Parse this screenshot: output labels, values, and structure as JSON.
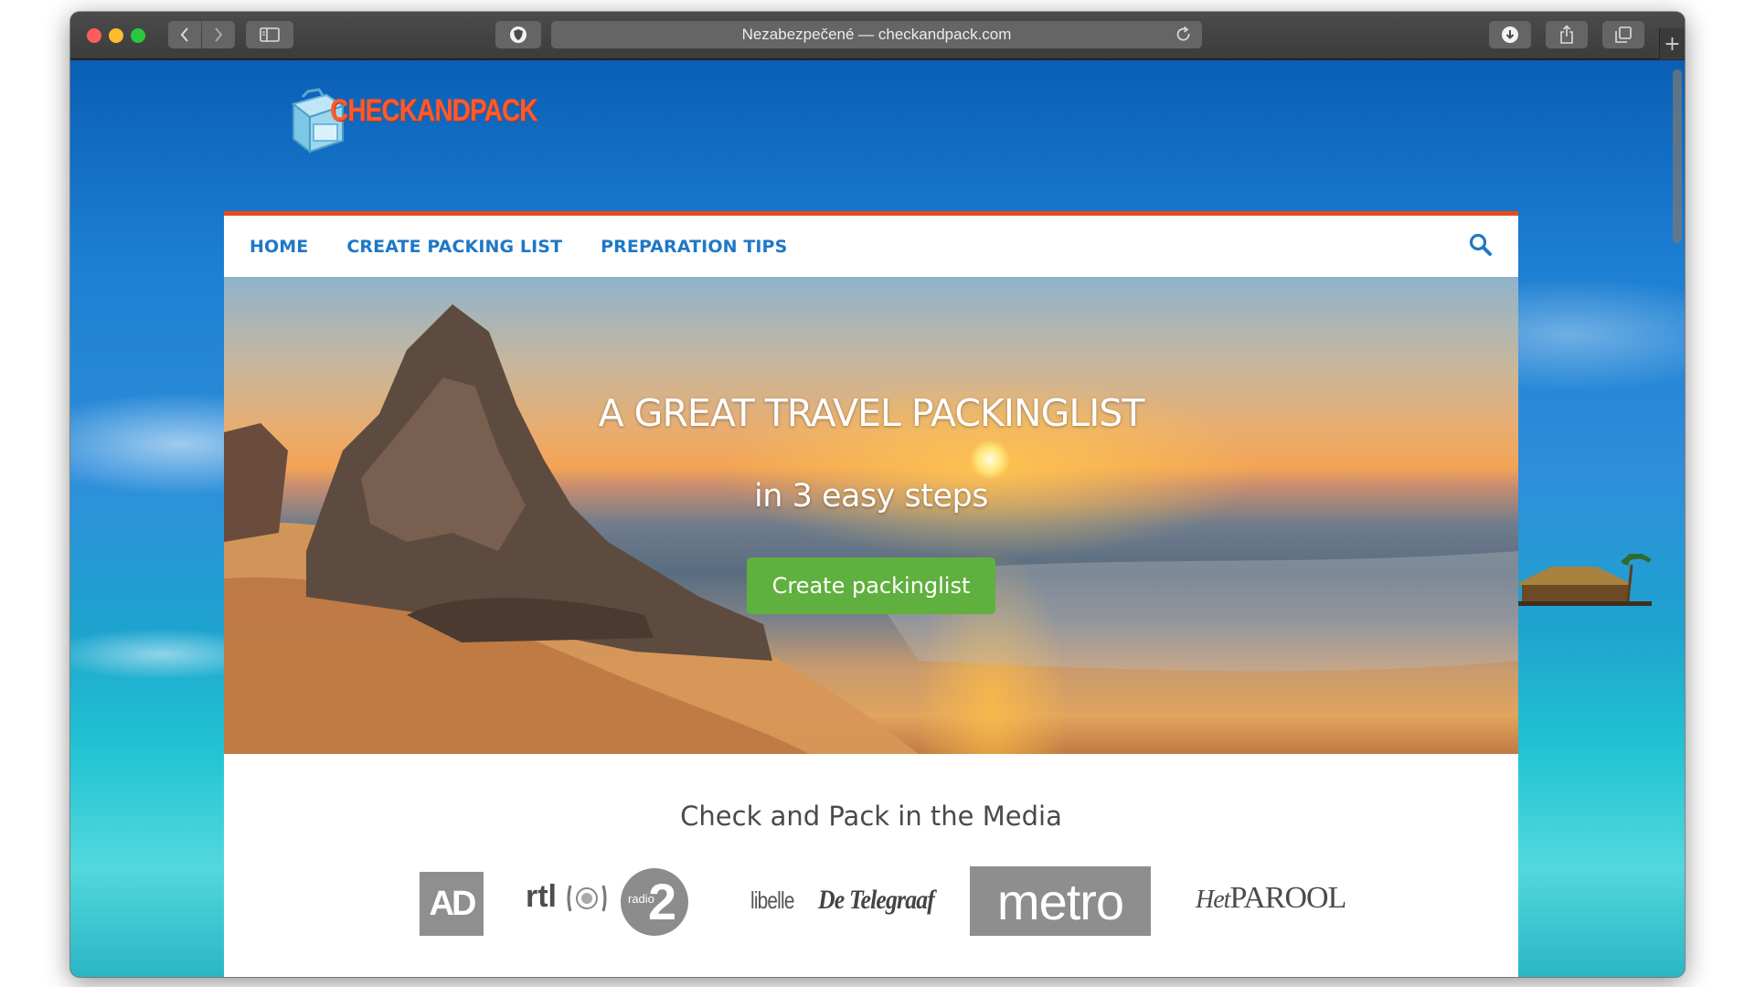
{
  "browser": {
    "address": "Nezabezpečené — checkandpack.com"
  },
  "site": {
    "logo_text": "CHECKANDPACK",
    "accent_color": "#ea4a1d",
    "link_color": "#1f78c6",
    "cta_color": "#5fb03e"
  },
  "nav": {
    "items": [
      {
        "label": "HOME"
      },
      {
        "label": "CREATE PACKING LIST"
      },
      {
        "label": "PREPARATION TIPS"
      }
    ],
    "search_icon": "search-icon"
  },
  "hero": {
    "title": "A GREAT TRAVEL PACKINGLIST",
    "subtitle": "in 3 easy steps",
    "cta_label": "Create packinglist"
  },
  "media": {
    "heading": "Check and Pack in the Media",
    "logos": {
      "ad": "AD",
      "rtl": "rtl",
      "radio2_label": "radio",
      "radio2_num": "2",
      "libelle": "libelle",
      "telegraaf": "De Telegraaf",
      "metro": "metro",
      "parool_het": "Het",
      "parool": "PAROOL"
    }
  }
}
